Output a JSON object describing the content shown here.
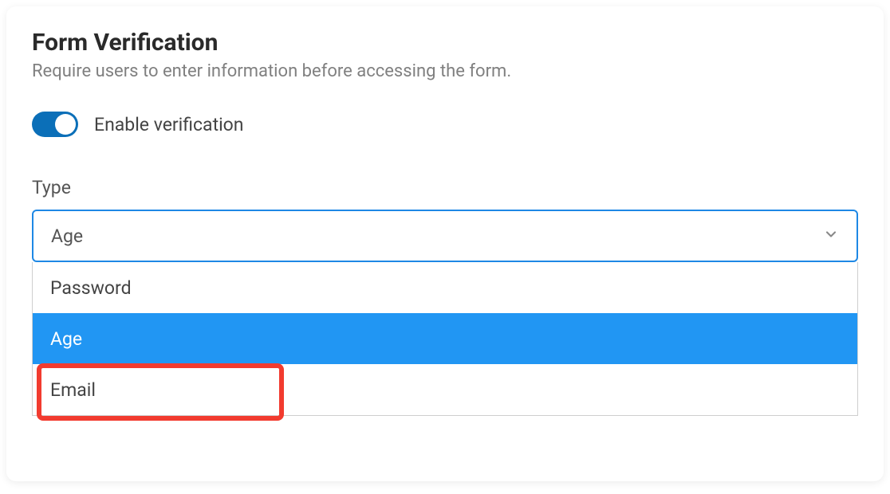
{
  "header": {
    "title": "Form Verification",
    "subtitle": "Require users to enter information before accessing the form."
  },
  "toggle": {
    "label": "Enable verification",
    "enabled": true
  },
  "type_field": {
    "label": "Type",
    "selected": "Age",
    "options": [
      "Password",
      "Age",
      "Email"
    ]
  }
}
